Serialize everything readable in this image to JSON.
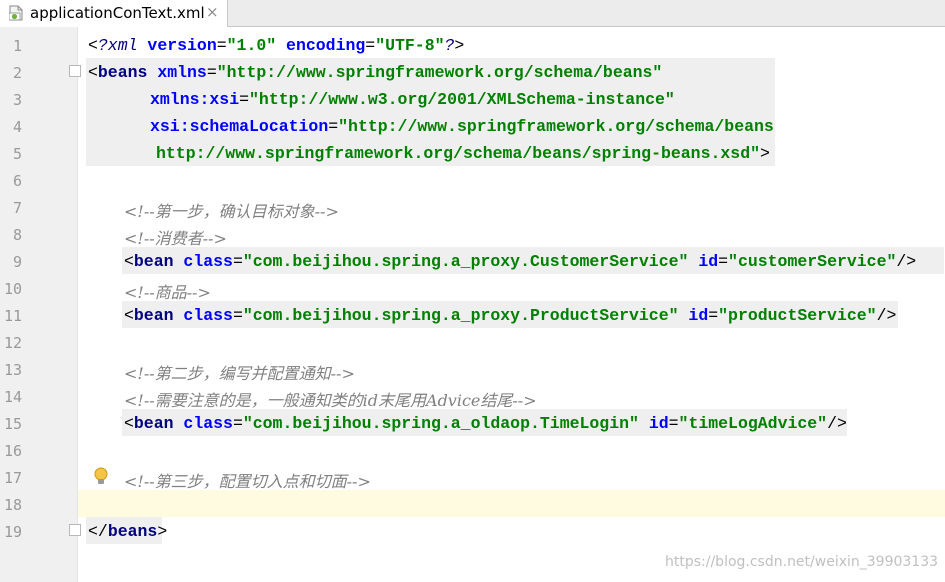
{
  "tab": {
    "title": "applicationConText.xml",
    "close_glyph": "×",
    "icon": "spring-xml-file-icon"
  },
  "lines": [
    {
      "num": "1",
      "segs": [
        [
          "br",
          "<"
        ],
        [
          "pi",
          "?xml "
        ],
        [
          "attr",
          "version"
        ],
        [
          "br",
          "="
        ],
        [
          "val",
          "\"1.0\""
        ],
        [
          "attr",
          " encoding"
        ],
        [
          "br",
          "="
        ],
        [
          "val",
          "\"UTF-8\""
        ],
        [
          "pi",
          "?"
        ],
        [
          "br",
          ">"
        ]
      ]
    },
    {
      "num": "2",
      "segs": [
        [
          "br",
          "<"
        ],
        [
          "tag",
          "beans "
        ],
        [
          "attr",
          "xmlns"
        ],
        [
          "br",
          "="
        ],
        [
          "val",
          "\"http://www.springframework.org/schema/beans\""
        ]
      ]
    },
    {
      "num": "3",
      "segs": [
        [
          "attr",
          "xmlns:xsi"
        ],
        [
          "br",
          "="
        ],
        [
          "val",
          "\"http://www.w3.org/2001/XMLSchema-instance\""
        ]
      ]
    },
    {
      "num": "4",
      "segs": [
        [
          "attr",
          "xsi:schemaLocation"
        ],
        [
          "br",
          "="
        ],
        [
          "val",
          "\"http://www.springframework.org/schema/beans"
        ]
      ]
    },
    {
      "num": "5",
      "segs": [
        [
          "val",
          "http://www.springframework.org/schema/beans/spring-beans.xsd\""
        ],
        [
          "br",
          ">"
        ]
      ]
    },
    {
      "num": "6",
      "segs": []
    },
    {
      "num": "7",
      "segs": [
        [
          "cmt",
          "<!--第一步，确认目标对象-->"
        ]
      ]
    },
    {
      "num": "8",
      "segs": [
        [
          "cmt",
          "<!--消费者-->"
        ]
      ]
    },
    {
      "num": "9",
      "segs": [
        [
          "br",
          "<"
        ],
        [
          "tag",
          "bean "
        ],
        [
          "attr",
          "class"
        ],
        [
          "br",
          "="
        ],
        [
          "val",
          "\"com.beijihou.spring.a_proxy.CustomerService\""
        ],
        [
          "attr",
          " id"
        ],
        [
          "br",
          "="
        ],
        [
          "val",
          "\"customerService\""
        ],
        [
          "br",
          "/>"
        ]
      ]
    },
    {
      "num": "10",
      "segs": [
        [
          "cmt",
          "<!--商品-->"
        ]
      ]
    },
    {
      "num": "11",
      "segs": [
        [
          "br",
          "<"
        ],
        [
          "tag",
          "bean "
        ],
        [
          "attr",
          "class"
        ],
        [
          "br",
          "="
        ],
        [
          "val",
          "\"com.beijihou.spring.a_proxy.ProductService\""
        ],
        [
          "attr",
          " id"
        ],
        [
          "br",
          "="
        ],
        [
          "val",
          "\"productService\""
        ],
        [
          "br",
          "/>"
        ]
      ]
    },
    {
      "num": "12",
      "segs": []
    },
    {
      "num": "13",
      "segs": [
        [
          "cmt",
          "<!--第二步，编写并配置通知-->"
        ]
      ]
    },
    {
      "num": "14",
      "segs": [
        [
          "cmt",
          "<!--需要注意的是，一般通知类的id末尾用Advice结尾-->"
        ]
      ]
    },
    {
      "num": "15",
      "segs": [
        [
          "br",
          "<"
        ],
        [
          "tag",
          "bean "
        ],
        [
          "attr",
          "class"
        ],
        [
          "br",
          "="
        ],
        [
          "val",
          "\"com.beijihou.spring.a_oldaop.TimeLogin\""
        ],
        [
          "attr",
          " id"
        ],
        [
          "br",
          "="
        ],
        [
          "val",
          "\"timeLogAdvice\""
        ],
        [
          "br",
          "/>"
        ]
      ]
    },
    {
      "num": "16",
      "segs": []
    },
    {
      "num": "17",
      "segs": [
        [
          "cmt",
          "<!--第三步，配置切入点和切面-->"
        ]
      ]
    },
    {
      "num": "18",
      "segs": []
    },
    {
      "num": "19",
      "segs": [
        [
          "br",
          "</"
        ],
        [
          "tag",
          "beans"
        ],
        [
          "br",
          ">"
        ]
      ]
    }
  ],
  "colors": {
    "tag": "#000080",
    "attribute": "#0000ff",
    "value": "#008000",
    "comment": "#808080",
    "caret_line": "#fffbe0",
    "gutter": "#f0f0f0"
  },
  "watermark": "https://blog.csdn.net/weixin_39903133"
}
